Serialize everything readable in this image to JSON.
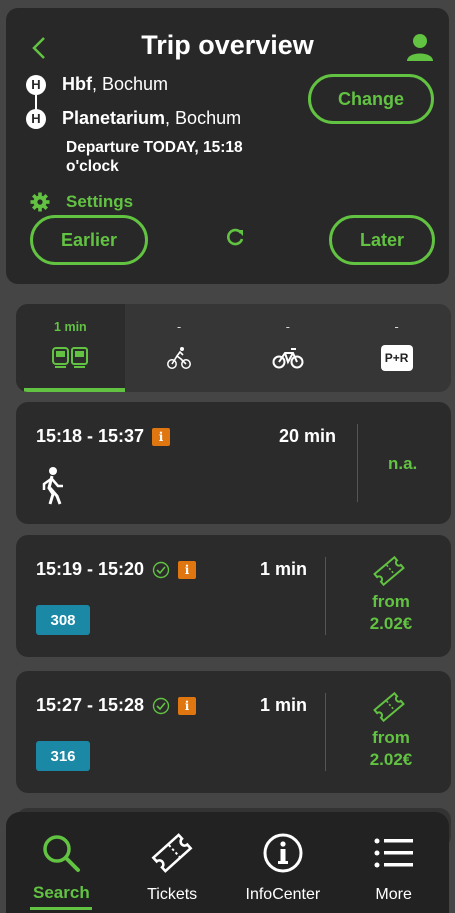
{
  "header": {
    "title": "Trip overview",
    "back_icon": "chevron-left-icon",
    "profile_icon": "person-icon",
    "origin": {
      "name": "Hbf",
      "city": ", Bochum",
      "badge": "H"
    },
    "destination": {
      "name": "Planetarium",
      "city": ", Bochum",
      "badge": "H"
    },
    "change_label": "Change",
    "departure_text": "Departure TODAY, 15:18 o'clock",
    "settings_label": "Settings",
    "earlier_label": "Earlier",
    "later_label": "Later",
    "accent_color": "#62c242"
  },
  "mode_tabs": [
    {
      "duration": "1 min",
      "icon": "public-transport-icon",
      "active": true
    },
    {
      "duration": "-",
      "icon": "cyclist-icon",
      "active": false
    },
    {
      "duration": "-",
      "icon": "bike-sharing-icon",
      "active": false
    },
    {
      "duration": "-",
      "icon": "park-and-ride-icon",
      "label": "P+R",
      "active": false
    }
  ],
  "trips": [
    {
      "time": "15:18 - 15:37",
      "info": "i",
      "duration": "20 min",
      "price": "n.a.",
      "mode": "walk-icon"
    },
    {
      "time": "15:19 - 15:20",
      "info": "i",
      "duration": "1 min",
      "line": "308",
      "price_from": "from",
      "price": "2.02€",
      "realtime": true
    },
    {
      "time": "15:27 - 15:28",
      "info": "i",
      "duration": "1 min",
      "line": "316",
      "price_from": "from",
      "price": "2.02€",
      "realtime": true
    }
  ],
  "line_color": "#1b89a6",
  "info_color": "#e0760f",
  "nav": [
    {
      "label": "Search",
      "icon": "search-icon",
      "active": true
    },
    {
      "label": "Tickets",
      "icon": "ticket-icon",
      "active": false
    },
    {
      "label": "InfoCenter",
      "icon": "info-icon",
      "active": false
    },
    {
      "label": "More",
      "icon": "menu-icon",
      "active": false
    }
  ]
}
